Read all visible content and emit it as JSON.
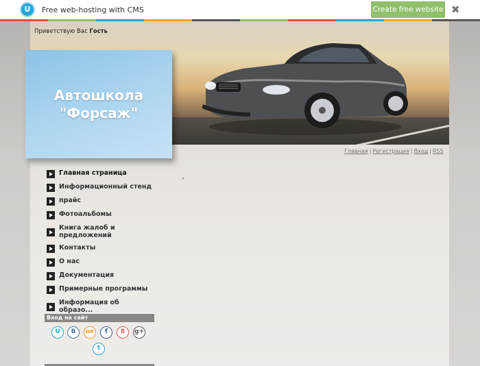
{
  "topbar": {
    "logo_letter": "U",
    "title": "Free web-hosting with CMS",
    "create_button": "Create free website",
    "close": "✖",
    "stripe_colors": [
      "#e74c3c",
      "#8fc06a",
      "#2aa4d8",
      "#f5a623",
      "#555555",
      "#8fc06a",
      "#e74c3c",
      "#2aa4d8",
      "#f5a623",
      "#555555"
    ]
  },
  "header": {
    "greeting_prefix": "Приветствую Вас",
    "greeting_user": "Гость",
    "site_title": "Автошкола\n\"Форсаж\""
  },
  "toplinks": [
    "Главная",
    "Регистрация",
    "Вход",
    "RSS"
  ],
  "toplinks_separator": "|",
  "menu": [
    {
      "label": "Главная страница",
      "current": true
    },
    {
      "label": "Информационный стенд"
    },
    {
      "label": "прайс"
    },
    {
      "label": "Фотоальбомы"
    },
    {
      "label": "Книга жалоб и предложений"
    },
    {
      "label": "Контакты"
    },
    {
      "label": "О нас"
    },
    {
      "label": "Документация"
    },
    {
      "label": "Примерные программы"
    },
    {
      "label": "Информация об образо..."
    }
  ],
  "login": {
    "heading": "Вход на сайт",
    "socials": [
      {
        "name": "ucoz-icon",
        "glyph": "U",
        "color": "#2aa4d8"
      },
      {
        "name": "vk-icon",
        "glyph": "B",
        "color": "#4a76a8"
      },
      {
        "name": "odnoklassniki-icon",
        "glyph": "ок",
        "color": "#f59a23"
      },
      {
        "name": "facebook-icon",
        "glyph": "f",
        "color": "#3b5998"
      },
      {
        "name": "mail-icon",
        "glyph": "8",
        "color": "#e05a5a"
      },
      {
        "name": "google-plus-icon",
        "glyph": "g+",
        "color": "#555555"
      },
      {
        "name": "twitter-icon",
        "glyph": "t",
        "color": "#2aa4d8"
      }
    ]
  }
}
